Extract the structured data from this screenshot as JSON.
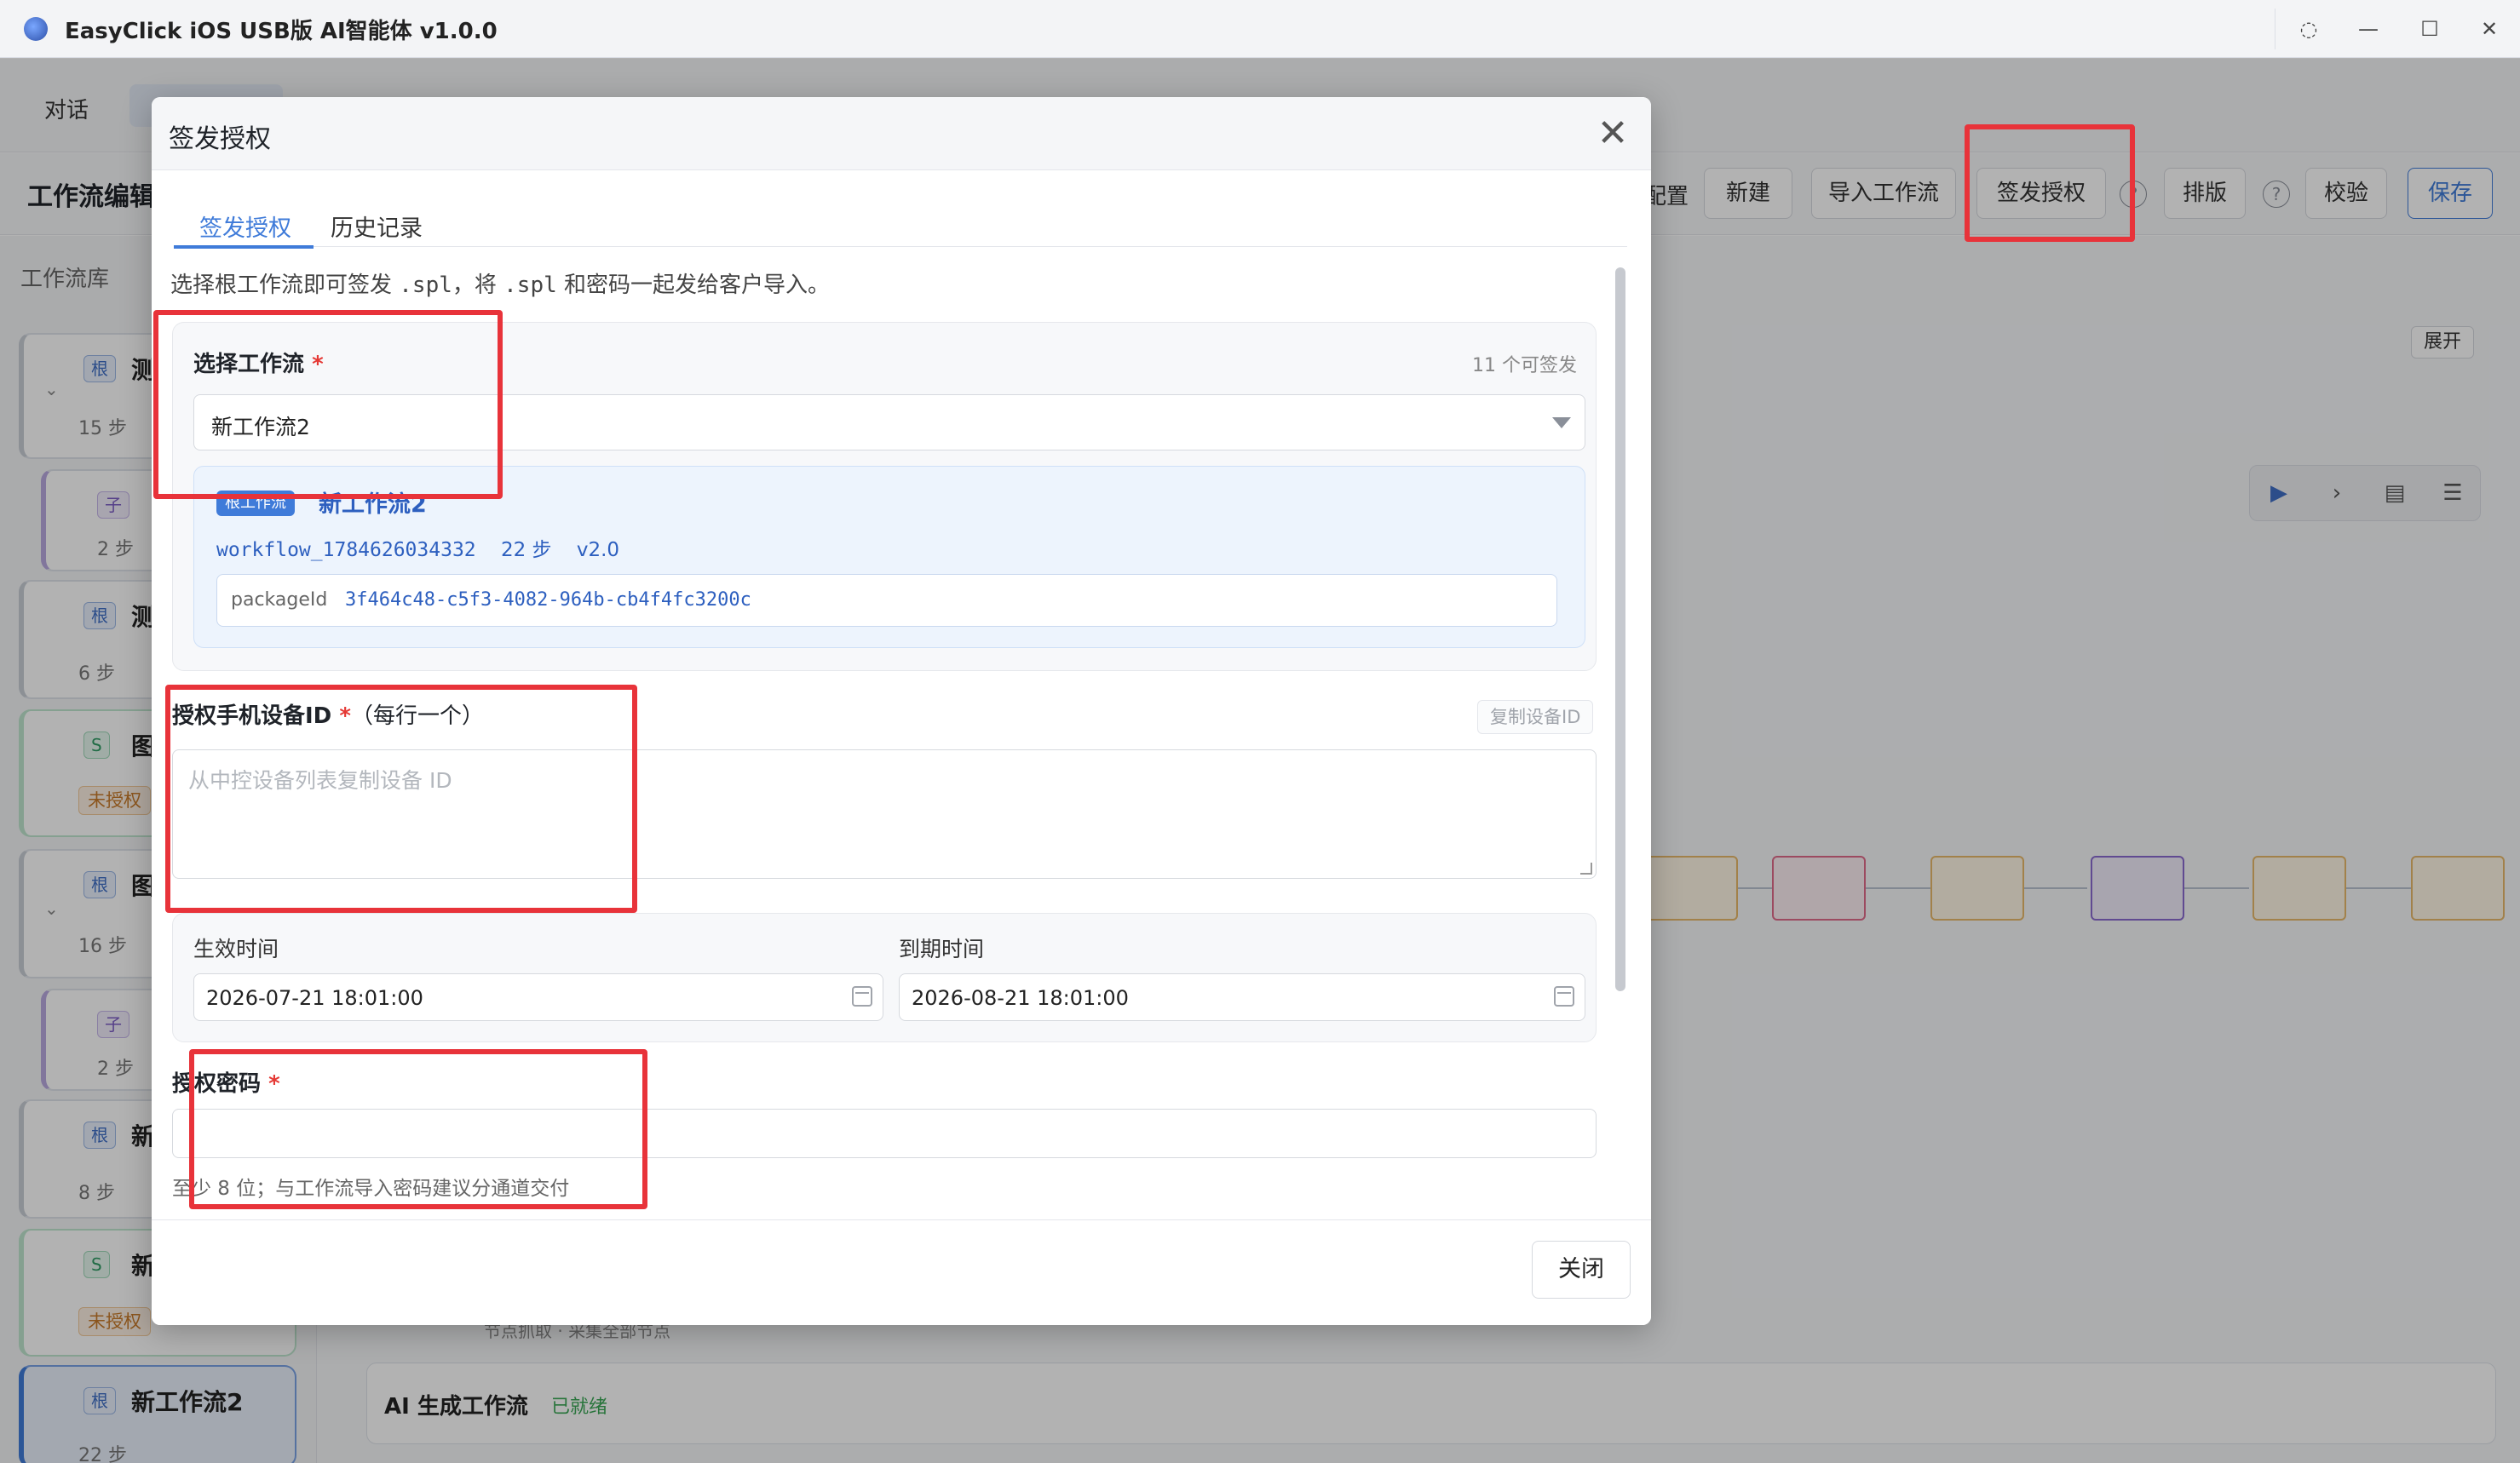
{
  "window": {
    "title": "EasyClick iOS USB版 AI智能体 v1.0.0",
    "controls": {
      "loading": "◌",
      "minimize": "—",
      "maximize": "☐",
      "close": "✕"
    }
  },
  "top_tabs": {
    "chat": "对话"
  },
  "toolbar": {
    "page_title": "工作流编辑",
    "cutoff_label": "配置",
    "new": "新建",
    "import": "导入工作流",
    "issue_license": "签发授权",
    "help": "?",
    "layout": "排版",
    "validate": "校验",
    "save": "保存"
  },
  "sidebar": {
    "title": "工作流库",
    "cards": [
      {
        "badge": "根",
        "name": "测",
        "steps": "15 步"
      },
      {
        "badge": "子",
        "name": "",
        "steps": "2 步"
      },
      {
        "badge": "根",
        "name": "测",
        "steps": "6 步"
      },
      {
        "badge": "S",
        "name": "图像",
        "status": "未授权"
      },
      {
        "badge": "根",
        "name": "图",
        "steps": "16 步"
      },
      {
        "badge": "子",
        "name": "",
        "steps": "2 步"
      },
      {
        "badge": "根",
        "name": "新",
        "steps": "8 步"
      },
      {
        "badge": "S",
        "name": "新工",
        "status": "未授权"
      },
      {
        "badge": "根",
        "name": "新工作流2",
        "steps": "22 步"
      }
    ]
  },
  "canvas": {
    "expand_top": "展开",
    "expand_bottom": "展开",
    "partial_text": "节点抓取 · 采集全部节点",
    "ai_title": "AI 生成工作流",
    "ai_status": "已就绪"
  },
  "modal": {
    "title": "签发授权",
    "close_icon": "✕",
    "tabs": [
      {
        "label": "签发授权",
        "active": true
      },
      {
        "label": "历史记录",
        "active": false
      }
    ],
    "intro_a": "选择根工作流即可签发 ",
    "intro_b": ".spl",
    "intro_c": "，将 ",
    "intro_d": ".spl",
    "intro_e": " 和密码一起发给客户导入。",
    "workflow": {
      "label": "选择工作流",
      "required": "*",
      "count": "11 个可签发",
      "selected": "新工作流2",
      "card": {
        "tag": "根工作流",
        "name": "新工作流2",
        "id": "workflow_1784626034332",
        "steps": "22 步",
        "version": "v2.0",
        "package_label": "packageId",
        "package_id": "3f464c48-c5f3-4082-964b-cb4f4fc3200c"
      }
    },
    "devices": {
      "label": "授权手机设备ID",
      "required": "*",
      "suffix": "（每行一个）",
      "copy_button": "复制设备ID",
      "placeholder": "从中控设备列表复制设备 ID"
    },
    "dates": {
      "start_label": "生效时间",
      "start_value": "2026-07-21 18:01:00",
      "end_label": "到期时间",
      "end_value": "2026-08-21 18:01:00"
    },
    "password": {
      "label": "授权密码",
      "required": "*",
      "hint": "至少 8 位；与工作流导入密码建议分通道交付"
    },
    "footer_close": "关闭"
  },
  "colors": {
    "accent": "#3f7bd9",
    "highlight": "#e8333a",
    "required": "#e53935"
  }
}
